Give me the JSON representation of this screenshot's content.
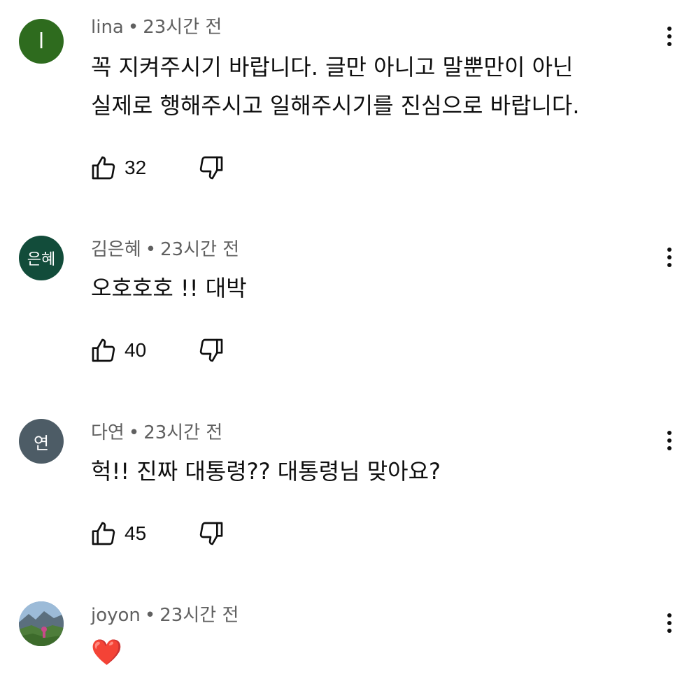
{
  "comments": [
    {
      "avatar_text": "l",
      "avatar_color": "#2e6b1e",
      "author": "lina",
      "separator": "•",
      "time": "23시간 전",
      "line1": "꼭 지켜주시기 바랍니다. 글만 아니고 말뿐만이 아닌",
      "line2": "실제로 행해주시고 일해주시기를 진심으로 바랍니다.",
      "likes": "32"
    },
    {
      "avatar_text": "은혜",
      "avatar_color": "#124c3a",
      "author": "김은혜",
      "separator": "•",
      "time": "23시간 전",
      "line1": "오호호호 !! 대박",
      "likes": "40"
    },
    {
      "avatar_text": "연",
      "avatar_color": "#4d5c66",
      "author": "다연",
      "separator": "•",
      "time": "23시간 전",
      "line1": "헉!! 진짜 대통령?? 대통령님 맞아요?",
      "likes": "45"
    },
    {
      "avatar_image": "landscape-photo",
      "author": "joyon",
      "separator": "•",
      "time": "23시간 전",
      "line1": "❤️"
    }
  ],
  "icons": {
    "like": "thumbs-up-icon",
    "dislike": "thumbs-down-icon",
    "more": "more-vertical-icon"
  }
}
